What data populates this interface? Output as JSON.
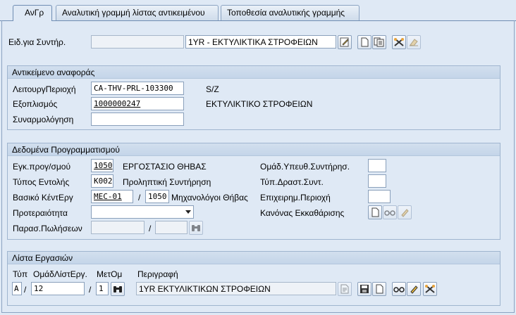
{
  "tabs": [
    {
      "label": "ΑνΓρ"
    },
    {
      "label": "Αναλυτική γραμμή λίστας αντικειμένου"
    },
    {
      "label": "Τοποθεσία αναλυτικής γραμμής"
    }
  ],
  "header": {
    "maint_type_label": "Ειδ.για Συντήρ.",
    "maint_type_code": "",
    "maint_type_desc": "1YR - ΕΚΤΥΛΙΚΤΙΚΑ ΣΤΡΟΦΕΙΩΝ"
  },
  "reference_object": {
    "title": "Αντικείμενο αναφοράς",
    "func_location_label": "ΛειτουργΠεριοχή",
    "func_location_value": "CA-THV-PRL-103300",
    "func_location_desc": "S/Z",
    "equipment_label": "Εξοπλισμός",
    "equipment_value": "1000000247",
    "equipment_desc": "ΕΚΤΥΛΙΚΤΙΚΟ ΣΤΡΟΦΕΙΩΝ",
    "assembly_label": "Συναρμολόγηση",
    "assembly_value": ""
  },
  "planning_data": {
    "title": "Δεδομένα Προγραμματισμού",
    "plant_label": "Εγκ.προγ/σμού",
    "plant_value": "1050",
    "plant_desc": "ΕΡΓΟΣΤΑΣΙΟ ΘΗΒΑΣ",
    "order_type_label": "Τύπος Εντολής",
    "order_type_value": "K002",
    "order_type_desc": "Προληπτική Συντήρηση",
    "work_center_label": "Βασικό ΚέντΕργ",
    "work_center_value": "MEC-01",
    "work_center_sep": "/",
    "work_center_plant": "1050",
    "work_center_desc": "Μηχανολόγοι Θήβας",
    "priority_label": "Προτεραιότητα",
    "priority_value": "",
    "sales_doc_label": "Παρασ.Πωλήσεων",
    "sales_doc_value": "",
    "sales_doc_sep": "/",
    "sales_doc_item": "",
    "planner_group_label": "Ομάδ.Υπευθ.Συντήρησ.",
    "planner_group_value": "",
    "activity_type_label": "Τύπ.Δραστ.Συντ.",
    "activity_type_value": "",
    "business_area_label": "Επιχειρημ.Περιοχή",
    "business_area_value": "",
    "settlement_rule_label": "Κανόνας Εκκαθάρισης"
  },
  "task_list": {
    "title": "Λίστα Εργασιών",
    "type_label": "Τύπ",
    "group_label": "ΟμάδΛίστΕργ.",
    "counter_label": "ΜετΟμ",
    "desc_label": "Περιγραφή",
    "type_value": "A",
    "sep1": "/",
    "group_value": "12",
    "sep2": "/",
    "counter_value": "1",
    "desc_value": "1YR ΕΚΤΥΛΙΚΤΙΚΩΝ ΣΤΡΟΦΕΙΩΝ"
  }
}
